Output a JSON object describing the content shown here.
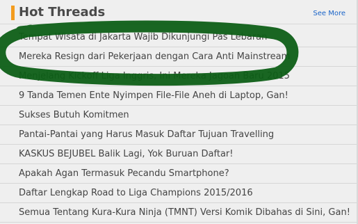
{
  "header": {
    "title": "Hot Threads",
    "see_more_label": "See More",
    "accent_color": "#f39c1f"
  },
  "threads": [
    {
      "title": "Tempat Wisata di Jakarta Wajib Dikunjungi Pas Lebaran"
    },
    {
      "title": "Mereka Resign dari Pekerjaan dengan Cara Anti Mainstream"
    },
    {
      "title": "Menjelang Kickoff Liga Inggris, Ini Mereka Jagoan Baru 2015"
    },
    {
      "title": "9 Tanda Temen Ente Nyimpen File-File Aneh di Laptop, Gan!"
    },
    {
      "title": "Sukses Butuh Komitmen"
    },
    {
      "title": "Pantai-Pantai yang Harus Masuk Daftar Tujuan Travelling"
    },
    {
      "title": "KASKUS BEJUBEL Balik Lagi, Yok Buruan Daftar!"
    },
    {
      "title": "Apakah Agan Termasuk Pecandu Smartphone?"
    },
    {
      "title": "Daftar Lengkap Road to Liga Champions 2015/2016"
    },
    {
      "title": "Semua Tentang Kura-Kura Ninja (TMNT) Versi Komik Dibahas di Sini, Gan!"
    }
  ],
  "annotation": {
    "color": "#0d5e16",
    "shape": "hand-drawn-oval"
  }
}
